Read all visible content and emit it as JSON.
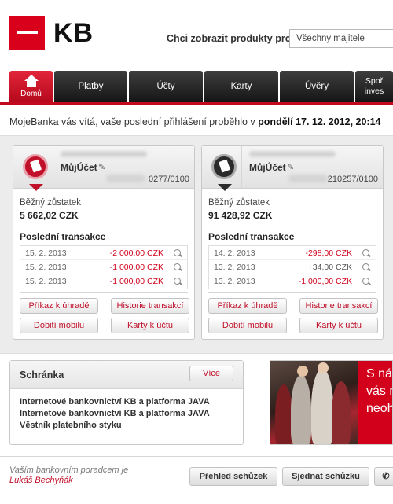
{
  "brand": {
    "logo_text": "KB",
    "color": "#d9001b"
  },
  "header": {
    "products_label": "Chci zobrazit produkty pro",
    "owner_select_value": "Všechny majitele"
  },
  "nav": {
    "tabs": [
      {
        "label": "Domů",
        "icon": "home-icon",
        "active": true
      },
      {
        "label": "Platby"
      },
      {
        "label": "Účty"
      },
      {
        "label": "Karty"
      },
      {
        "label": "Úvěry"
      },
      {
        "label_line1": "Spoř",
        "label_line2": "inves"
      }
    ]
  },
  "welcome": {
    "text": "MojeBanka vás vítá, vaše poslední přihlášení proběhlo v ",
    "date": "pondělí 17. 12. 2012, 20:14"
  },
  "accounts": [
    {
      "name": "MůjÚčet",
      "number": "0277/0100",
      "balance_label": "Běžný zůstatek",
      "balance": "5 662,02 CZK",
      "transactions_title": "Poslední transakce",
      "transactions": [
        {
          "date": "15. 2. 2013",
          "amount": "-2 000,00 CZK"
        },
        {
          "date": "15. 2. 2013",
          "amount": "-1 000,00 CZK"
        },
        {
          "date": "15. 2. 2013",
          "amount": "-1 000,00 CZK"
        }
      ],
      "buttons": {
        "payment": "Příkaz k úhradě",
        "history": "Historie transakcí",
        "topup": "Dobití mobilu",
        "cards": "Karty k účtu"
      }
    },
    {
      "name": "MůjÚčet",
      "number": "210257/0100",
      "balance_label": "Běžný zůstatek",
      "balance": "91 428,92 CZK",
      "transactions_title": "Poslední transakce",
      "transactions": [
        {
          "date": "14. 2. 2013",
          "amount": "-298,00 CZK"
        },
        {
          "date": "13. 2. 2013",
          "amount": "+34,00 CZK"
        },
        {
          "date": "13. 2. 2013",
          "amount": "-1 000,00 CZK"
        }
      ],
      "buttons": {
        "payment": "Příkaz k úhradě",
        "history": "Historie transakcí",
        "topup": "Dobití mobilu",
        "cards": "Karty k účtu"
      }
    }
  ],
  "inbox": {
    "title": "Schránka",
    "more_label": "Více",
    "items": [
      "Internetové bankovnictví KB a platforma JAVA",
      "Internetové bankovnictví KB a platforma JAVA",
      "Věstník platebního styku"
    ]
  },
  "promo": {
    "line1": "S ná",
    "line2": "vás n",
    "line3": "neoh"
  },
  "footer": {
    "advisor_label": "Vaším bankovním poradcem je",
    "advisor_name": "Lukáš Bechyňák",
    "meetings_overview": "Přehled schůzek",
    "schedule_meeting": "Sjednat schůzku"
  }
}
